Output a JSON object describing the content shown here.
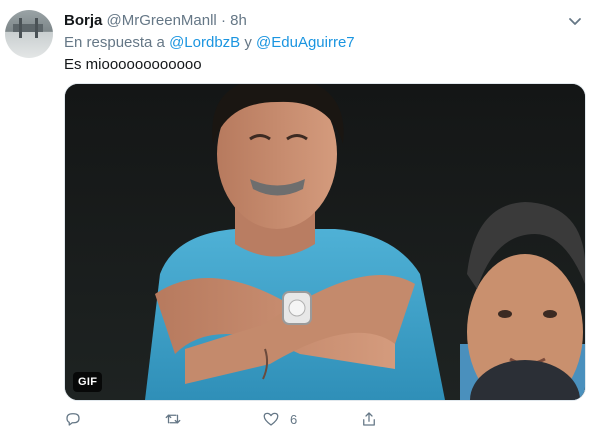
{
  "tweet": {
    "display_name": "Borja",
    "handle": "@MrGreenManll",
    "separator": "·",
    "time": "8h",
    "reply_prefix": "En respuesta a",
    "reply_to_1": "@LordbzB",
    "reply_joiner": "y",
    "reply_to_2": "@EduAguirre7",
    "text": "Es mioooooooooooo",
    "media": {
      "badge": "GIF"
    },
    "actions": {
      "reply_icon": "reply-icon",
      "retweet_icon": "retweet-icon",
      "like_icon": "heart-icon",
      "like_count": "6",
      "share_icon": "share-icon"
    }
  },
  "colors": {
    "link": "#1b95e0",
    "secondary": "#657786",
    "primary_text": "#14171a"
  }
}
